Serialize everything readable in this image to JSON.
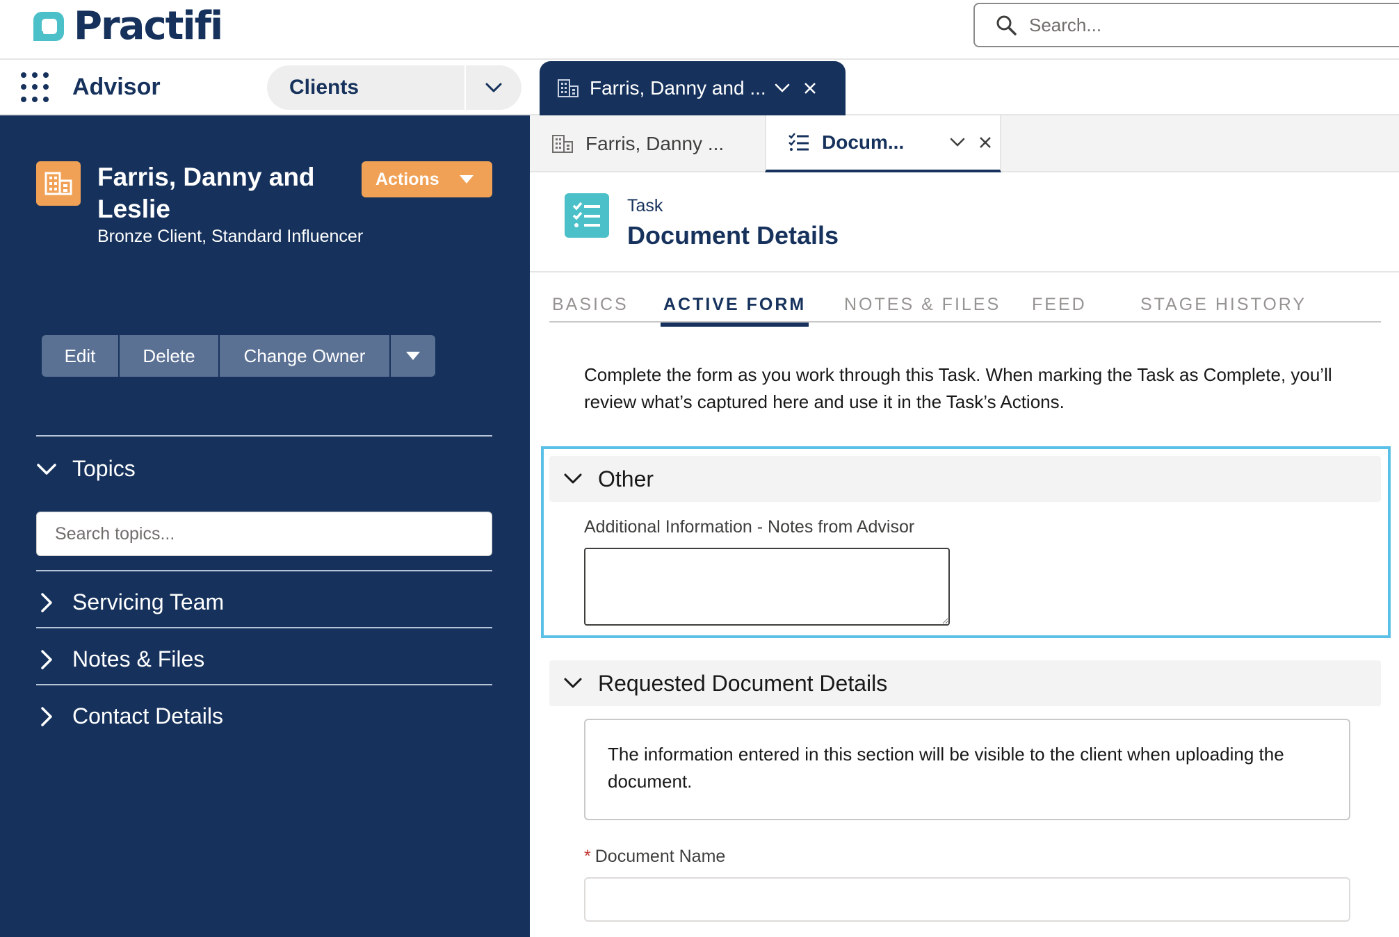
{
  "app": {
    "brand": "Practifi",
    "name": "Advisor",
    "search_placeholder": "Search..."
  },
  "nav": {
    "object_selector": "Clients",
    "workspace_tab": "Farris, Danny and ..."
  },
  "subtabs": [
    {
      "label": "Farris, Danny ..."
    },
    {
      "label": "Docum..."
    }
  ],
  "account": {
    "name": "Farris, Danny and Leslie",
    "subtitle": "Bronze Client, Standard Influencer",
    "actions_label": "Actions",
    "buttons": [
      "Edit",
      "Delete",
      "Change Owner"
    ]
  },
  "sidebar": {
    "topics_label": "Topics",
    "topic_search_placeholder": "Search topics...",
    "sections": [
      "Servicing Team",
      "Notes & Files",
      "Contact Details"
    ]
  },
  "record": {
    "type": "Task",
    "title": "Document Details"
  },
  "tabs": [
    "BASICS",
    "ACTIVE FORM",
    "NOTES & FILES",
    "FEED",
    "STAGE HISTORY"
  ],
  "active_tab": "ACTIVE FORM",
  "form": {
    "intro": "Complete the form as you work through this Task. When marking the Task as Complete, you’ll review what’s captured here and use it in the Task’s Actions.",
    "section_other": "Other",
    "notes_label": "Additional Information - Notes from Advisor",
    "notes_value": "",
    "section_requested": "Requested Document Details",
    "info_text": "The information entered in this section will be visible to the client when uploading the document.",
    "required_mark": "*",
    "doc_name_label": "Document Name",
    "doc_name_value": ""
  },
  "colors": {
    "navy": "#16325c",
    "orange": "#f0a155",
    "teal": "#4bc0c8",
    "highlight": "#5bc0e6"
  }
}
